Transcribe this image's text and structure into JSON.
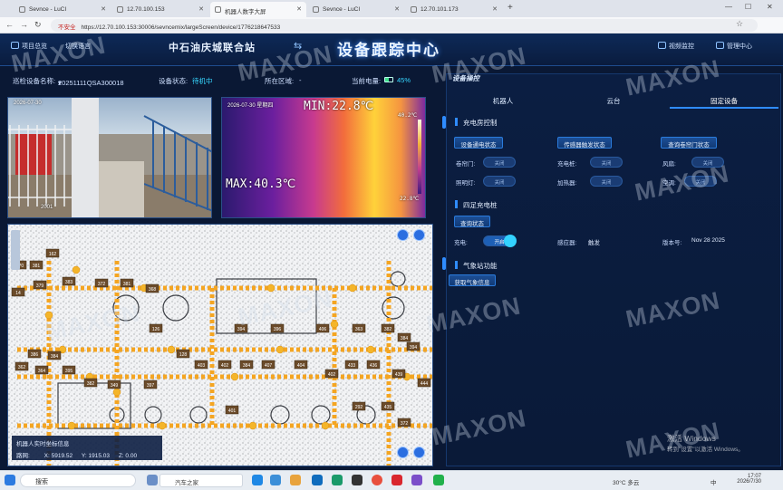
{
  "browser": {
    "tabs": [
      {
        "title": "Sevnce - LuCI",
        "active": false
      },
      {
        "title": "12.70.100.153",
        "active": false
      },
      {
        "title": "机器人数字大屏",
        "active": true
      },
      {
        "title": "Sevnce - LuCI",
        "active": false
      },
      {
        "title": "12.70.101.173",
        "active": false
      }
    ],
    "new_tab": "+",
    "insecure_label": "不安全",
    "url": "https://12.70.100.153:30006/sevncemix/largeScreen/device/1776218647533"
  },
  "header": {
    "project_overview": "项目总览",
    "switch_language": "切换语言",
    "station": "中石油庆城联合站",
    "title": "设备跟踪中心",
    "video_monitor": "视频监控",
    "management_center": "管理中心"
  },
  "info": {
    "device_name_label": "巡检设备名称:",
    "device_name": "20251111QSA300018",
    "status_label": "设备状态:",
    "status": "待机中",
    "area_label": "所在区域:",
    "area": "-",
    "battery_label": "当前电量:",
    "battery": "45%",
    "battery_level": 0.45
  },
  "camera": {
    "visible_timestamp": "2026-07-30",
    "visible_corner": "2001",
    "thermal_timestamp": "2026-07-30 星期四",
    "thermal_min": "MIN:22.8℃",
    "thermal_max": "MAX:40.3℃",
    "scale_top": "40.2℃",
    "scale_bottom": "22.8℃"
  },
  "map": {
    "coord_title": "机器人实时坐标信息",
    "route_label": "路网:",
    "x_label": "X:",
    "x": "5919.52",
    "y_label": "Y:",
    "y": "1915.03",
    "z_label": "Z:",
    "z": "0.00",
    "markers": [
      "370",
      "381",
      "162",
      "14",
      "379",
      "383",
      "372",
      "381",
      "368",
      "126",
      "394",
      "396",
      "406",
      "363",
      "382",
      "384",
      "394",
      "386",
      "384",
      "128",
      "403",
      "402",
      "384",
      "407",
      "404",
      "402",
      "433",
      "436",
      "439",
      "444",
      "362",
      "364",
      "395",
      "382",
      "349",
      "397",
      "292",
      "401",
      "435",
      "372"
    ]
  },
  "panel": {
    "title": "设备操控",
    "tabs": [
      "机器人",
      "云台",
      "固定设备"
    ],
    "charging_room": {
      "title": "充电房控制",
      "buttons": [
        "设备通电状态",
        "传感器触发状态",
        "查询卷帘门状态"
      ],
      "rows": [
        [
          {
            "label": "卷帘门:",
            "state": "关闭"
          },
          {
            "label": "充电桩:",
            "state": "关闭"
          },
          {
            "label": "风扇:",
            "state": "关闭"
          }
        ],
        [
          {
            "label": "照明灯:",
            "state": "关闭"
          },
          {
            "label": "加热器:",
            "state": "关闭"
          },
          {
            "label": "空调:",
            "state": "关闭"
          }
        ]
      ]
    },
    "charger": {
      "title": "四足充电桩",
      "query_button": "查询状态",
      "charge_label": "充电:",
      "charge_state": "开启",
      "sensor_label": "感应器:",
      "sensor_value": "触发",
      "version_label": "版本号:",
      "version_value": "Nov 28 2025"
    },
    "weather_station": {
      "title": "气象站功能",
      "button": "获取气象信息"
    }
  },
  "watermark": "MAXON",
  "activate": {
    "title": "激活 Windows",
    "subtitle": "转到\"设置\"以激活 Windows。"
  },
  "taskbar": {
    "search": "搜索",
    "news": "汽车之家",
    "weather": "30°C 多云",
    "ime": "中",
    "time": "17:07",
    "date": "2026/7/30"
  }
}
